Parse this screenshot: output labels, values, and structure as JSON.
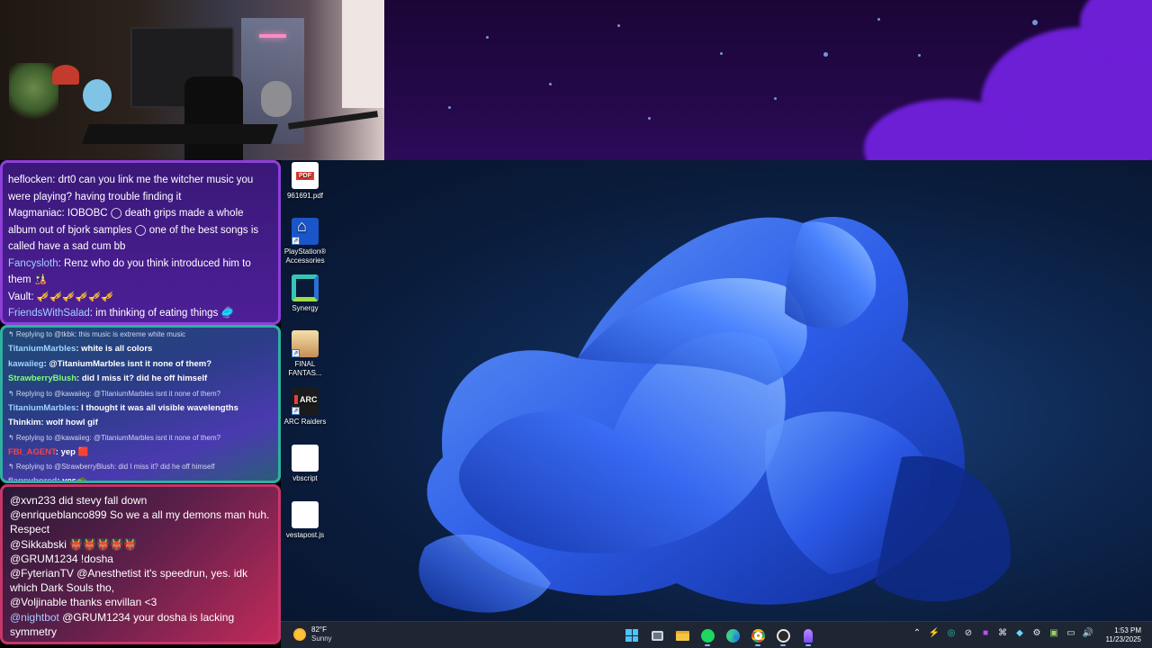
{
  "colors": {
    "accent": "#4cc2ff",
    "chat1_border": "#8d3fd8",
    "chat2_border": "#2fb0a0",
    "chat3_border": "#c6366a",
    "taskbar": "#1e2633"
  },
  "desktop_icons": [
    {
      "label": "961691.pdf",
      "icon": "pdf-file-icon"
    },
    {
      "label": "PlayStation® Accessories",
      "icon": "playstation-accessories-icon"
    },
    {
      "label": "Synergy",
      "icon": "synergy-icon"
    },
    {
      "label": "FINAL FANTAS...",
      "icon": "final-fantasy-icon"
    },
    {
      "label": "ARC Raiders",
      "icon": "arc-raiders-icon"
    },
    {
      "label": "vbscript",
      "icon": "blank-file-icon"
    },
    {
      "label": "vestapost.js",
      "icon": "blank-file-icon"
    }
  ],
  "chat1": {
    "messages": [
      {
        "name": "heflocken",
        "text": ": drt0 can you link me the witcher music you were playing? having trouble finding it",
        "color": "#ffffff"
      },
      {
        "name": "Magmaniac",
        "text": ": IOBOBC ◯ death grips made a whole album out of bjork samples ◯ one of the best songs is called have a sad cum bb",
        "color": "#ffffff"
      },
      {
        "name": "Fancysloth",
        "text": ": Renz who do you think introduced him to them 🎎",
        "color": "#9fd3ff"
      },
      {
        "name": "Vault",
        "text": ": 🎺🎺🎺🎺🎺🎺",
        "color": "#ffffff"
      },
      {
        "name": "FriendsWithSalad",
        "text": ": im thinking of eating things 🥏",
        "color": "#9fd3ff"
      }
    ]
  },
  "chat2": {
    "items": [
      {
        "type": "reply",
        "text": "↰ Replying to @tkbk: this music is extreme white music"
      },
      {
        "type": "msg",
        "name": "TitaniumMarbles",
        "text": ": white is all colors",
        "color": "#9fd3ff"
      },
      {
        "type": "msg",
        "name": "kawaiieg",
        "text": ": @TitaniumMarbles isnt it none of them?",
        "color": "#9fd3ff"
      },
      {
        "type": "msg",
        "name": "StrawberryBlush",
        "text": ": did I miss it? did he off himself",
        "color": "#7dff7a"
      },
      {
        "type": "reply",
        "text": "↰ Replying to @kawaiieg: @TitaniumMarbles isnt it none of them?"
      },
      {
        "type": "msg",
        "name": "TitaniumMarbles",
        "text": ": I thought it was all visible wavelengths",
        "color": "#9fd3ff"
      },
      {
        "type": "msg",
        "name": "Thinkim",
        "text": ": wolf howl gif",
        "color": "#ffffff"
      },
      {
        "type": "reply",
        "text": "↰ Replying to @kawaiieg: @TitaniumMarbles isnt it none of them?"
      },
      {
        "type": "msg",
        "name": "FBI_AGENT",
        "text": ": yep 🟥",
        "color": "#ff4040"
      },
      {
        "type": "reply",
        "text": "↰ Replying to @StrawberryBlush: did I miss it? did he off himself"
      },
      {
        "type": "msg",
        "name": "flappybored",
        "text": ": yes🐢",
        "color": "#b99bff"
      }
    ]
  },
  "chat3": {
    "messages": [
      {
        "name": "@xvn233",
        "text": " did stevy fall down",
        "color": "#ffffff"
      },
      {
        "name": "@enriqueblanco899",
        "text": " So we a all my demons man huh. Respect",
        "color": "#ffffff"
      },
      {
        "name": "@Sikkabski",
        "text": " 👹👹👹👹👹",
        "color": "#ffffff"
      },
      {
        "name": "@GRUM1234",
        "text": " !dosha",
        "color": "#ffffff"
      },
      {
        "name": "@FyterianTV",
        "text": " @Anesthetist it's speedrun, yes. idk which Dark Souls tho,",
        "color": "#ffffff"
      },
      {
        "name": "@Voljinable",
        "text": "  thanks envillan <3",
        "color": "#ffffff"
      },
      {
        "name": "@nightbot",
        "text": " @GRUM1234 your dosha is lacking symmetry",
        "color": "#a9c8ff"
      }
    ]
  },
  "taskbar": {
    "weather_temp": "82°F",
    "weather_desc": "Sunny",
    "apps": [
      "windows-start-icon",
      "task-view-icon",
      "file-explorer-icon",
      "spotify-icon",
      "edge-icon",
      "chrome-icon",
      "obs-icon",
      "stream-app-icon"
    ],
    "tray": [
      "chevron-up-icon",
      "tray-app-1-icon",
      "tray-app-2-icon",
      "tray-app-3-icon",
      "tray-app-4-icon",
      "steam-icon",
      "tray-app-5-icon",
      "tray-app-6-icon",
      "tray-app-7-icon",
      "network-icon",
      "volume-icon"
    ],
    "time": "1:53 PM",
    "date": "11/23/2025"
  }
}
